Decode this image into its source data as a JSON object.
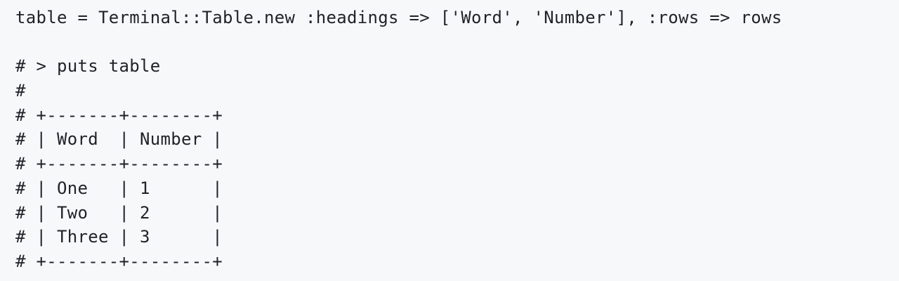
{
  "code_block": {
    "lines": [
      "table = Terminal::Table.new :headings => ['Word', 'Number'], :rows => rows",
      "",
      "# > puts table",
      "#",
      "# +-------+--------+",
      "# | Word  | Number |",
      "# +-------+--------+",
      "# | One   | 1      |",
      "# | Two   | 2      |",
      "# | Three | 3      |",
      "# +-------+--------+"
    ]
  },
  "colors": {
    "background": "#f6f8fa",
    "text": "#1f2328"
  }
}
